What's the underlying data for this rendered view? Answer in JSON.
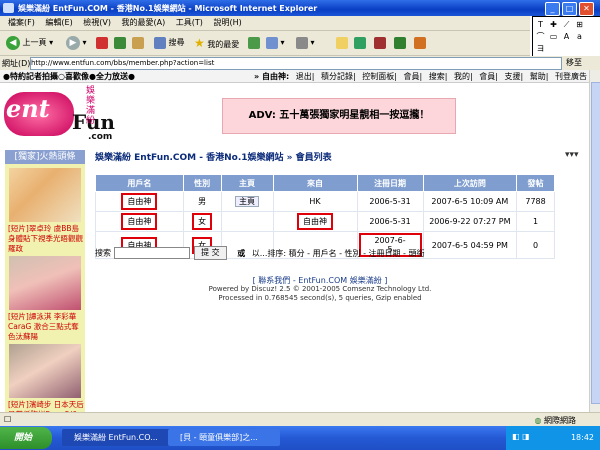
{
  "window": {
    "title": "娛樂滿紛 EntFun.COM - 香港No.1娛樂網站 - Microsoft Internet Explorer"
  },
  "menu": [
    "檔案(F)",
    "編輯(E)",
    "檢視(V)",
    "我的最愛(A)",
    "工具(T)",
    "說明(H)"
  ],
  "toolbar": {
    "back": "上一頁",
    "search": "搜尋",
    "favorites": "我的最愛"
  },
  "address": {
    "label": "網址(D)",
    "url": "http://www.entfun.com/bbs/member.php?action=list",
    "go": "移至"
  },
  "popup_glyphs": [
    "T",
    "✚",
    "⟋",
    "⊞",
    "⌒",
    "▭",
    "A",
    "a",
    "ヨ"
  ],
  "topnav": {
    "left": "●特約記者拍攝○喜歡像●全力放送●",
    "user_label": "» 自由神:",
    "links": [
      "退出",
      "積分記錄",
      "控制面板",
      "會員",
      "搜索",
      "我的",
      "會員",
      "支援",
      "幫助",
      "刊登廣告"
    ]
  },
  "logo": {
    "text1": "ent",
    "text2": "Fun",
    "text3": ".com",
    "tag": "娛樂滿紛"
  },
  "ad": {
    "text": "ADV: 五十萬張獨家明星靚相一按逗攏！"
  },
  "sidebar": {
    "title": "[獨家]火熱頭條",
    "items": [
      {
        "caption": "[短片]翠卓玲 虞BB島身體貼下視季光晤觀觀羅政"
      },
      {
        "caption": "[短片]譚泳淇 李彩華 CaraG 激合三點式奪色汰蘇陽"
      },
      {
        "caption": "[短片]濱崎步 日本天后吊帶低胸拼Fans 5/6"
      }
    ]
  },
  "site_title": "娛樂滿紛 EntFun.COM - 香港No.1娛樂網站 » 會員列表",
  "table": {
    "headers": [
      "用戶名",
      "性別",
      "主頁",
      "來自",
      "注冊日期",
      "上次訪問",
      "發帖"
    ],
    "rows": [
      {
        "user": "自由神",
        "gender": "男",
        "home": "主頁",
        "from": "HK",
        "reg": "2006-5-31",
        "last": "2007-6-5 10:09 AM",
        "posts": "7788"
      },
      {
        "user": "自由神",
        "gender": "女",
        "home": "",
        "from": "自由神",
        "reg": "2006-5-31",
        "last": "2006-9-22 07:27 PM",
        "posts": "1"
      },
      {
        "user": "自由神",
        "gender": "女",
        "home": "",
        "from": "",
        "reg": "2007-6-5",
        "last": "2007-6-5 04:59 PM",
        "posts": "0"
      }
    ]
  },
  "search": {
    "label": "搜索",
    "button": "提 交",
    "or": "或",
    "sort": "以...排序: 積分 - 用戶名 - 性別 - 注冊日期 - 頭銜"
  },
  "footer": {
    "line1": "[ 聯系我們 - EntFun.COM 娛樂滿紛 ]",
    "line2": "Powered by Discuz! 2.5 © 2001-2005 Comsenz Technology Ltd.",
    "line3": "Processed in 0.768545 second(s), 5 queries, Gzip enabled"
  },
  "status": {
    "zone": "網際網路"
  },
  "taskbar": {
    "start": "開始",
    "task1": "娛樂滿紛 EntFun.CO...",
    "task2": "[貝 - 頤童俱樂部]之...",
    "clock": "18:42"
  }
}
